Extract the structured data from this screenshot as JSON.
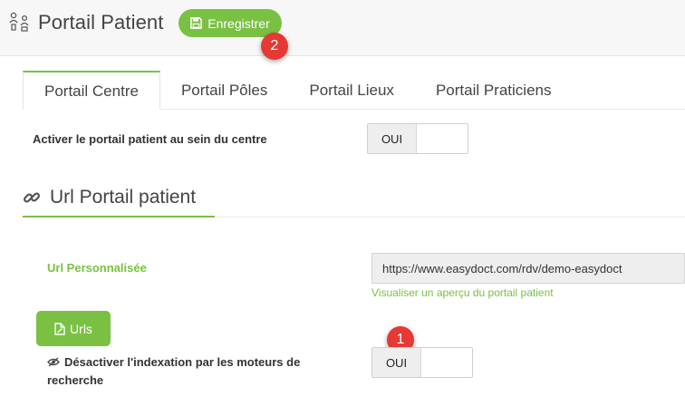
{
  "header": {
    "title": "Portail Patient",
    "save_label": "Enregistrer",
    "icon": "patient-doctor-icon"
  },
  "badges": {
    "first": "1",
    "second": "2"
  },
  "tabs": [
    {
      "label": "Portail Centre",
      "active": true
    },
    {
      "label": "Portail Pôles",
      "active": false
    },
    {
      "label": "Portail Lieux",
      "active": false
    },
    {
      "label": "Portail Praticiens",
      "active": false
    }
  ],
  "activate": {
    "label": "Activer le portail patient au sein du centre",
    "toggle_value": "OUI"
  },
  "section": {
    "title": "Url Portail patient",
    "icon": "link-icon"
  },
  "url": {
    "label": "Url Personnalisée",
    "value": "https://www.easydoct.com/rdv/demo-easydoct",
    "preview_link": "Visualiser un aperçu du portail patient"
  },
  "urls_button": {
    "label": "Urls",
    "icon": "file-edit-icon"
  },
  "indexation": {
    "label": "Désactiver l'indexation par les moteurs de recherche",
    "toggle_value": "OUI",
    "icon": "eye-slash-icon"
  },
  "colors": {
    "accent": "#7ac143",
    "badge": "#e53935"
  }
}
